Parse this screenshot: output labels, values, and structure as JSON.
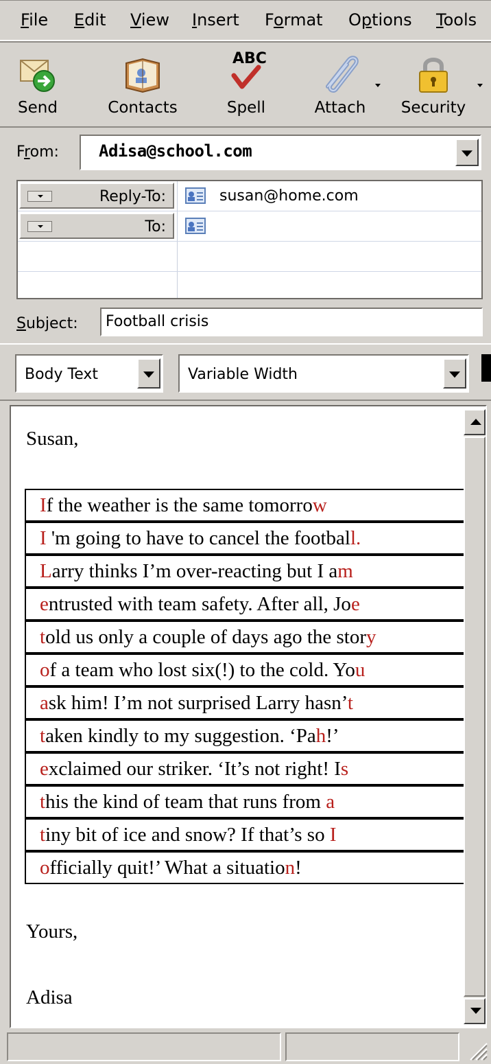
{
  "menu": [
    {
      "label": "File",
      "ul": "F",
      "rest": "ile"
    },
    {
      "label": "Edit",
      "ul": "E",
      "rest": "dit"
    },
    {
      "label": "View",
      "ul": "V",
      "rest": "iew"
    },
    {
      "label": "Insert",
      "ul": "I",
      "rest": "nsert"
    },
    {
      "label": "Format",
      "pre": "F",
      "ul": "o",
      "rest": "rmat"
    },
    {
      "label": "Options",
      "pre": "O",
      "ul": "p",
      "rest": "tions"
    },
    {
      "label": "Tools",
      "ul": "T",
      "rest": "ools"
    }
  ],
  "toolbar": {
    "send": "Send",
    "contacts": "Contacts",
    "spell": "Spell",
    "spell_icon_text": "ABC",
    "attach": "Attach",
    "security": "Security"
  },
  "from": {
    "label_pre": "F",
    "label_ul": "r",
    "label_rest": "om:",
    "value": "Adisa@school.com"
  },
  "addresses": [
    {
      "type": "Reply-To:",
      "value": "susan@home.com"
    },
    {
      "type": "To:",
      "value": ""
    }
  ],
  "subject": {
    "label_ul": "S",
    "label_rest": "ubject:",
    "value": "Football crisis"
  },
  "format": {
    "paragraph_style": "Body Text",
    "font": "Variable Width"
  },
  "body": {
    "greeting": "Susan,",
    "lines": [
      {
        "first": "I",
        "middle": "f the weather is the same tomorro",
        "last": "w"
      },
      {
        "first": "I",
        "middle": " 'm going to have to cancel the footbal",
        "last": "l."
      },
      {
        "first": "L",
        "middle": "arry thinks I’m over-reacting but I a",
        "last": "m"
      },
      {
        "first": "e",
        "middle": "ntrusted with team safety. After all,  Jo",
        "last": "e"
      },
      {
        "first": "t",
        "middle": "old us only a couple of days  ago the stor",
        "last": "y"
      },
      {
        "first": "o",
        "middle": "f a team who lost six(!) to the cold. Yo",
        "last": "u"
      },
      {
        "first": "a",
        "middle": "sk him! I’m not surprised Larry hasn’",
        "last": "t"
      },
      {
        "first": "t",
        "middle": "aken kindly to my suggestion. ‘Pa",
        "last": "h",
        "after": "!’"
      },
      {
        "first": "e",
        "middle": "xclaimed our striker. ‘It’s not right! I",
        "last": "s"
      },
      {
        "first": "t",
        "middle": "his the kind of team that runs from ",
        "last": "a"
      },
      {
        "first": "t",
        "middle": "iny bit of ice and snow? If that’s so ",
        "last": "I"
      },
      {
        "first": "o",
        "middle": "fficially quit!’  What a situatio",
        "last": "n",
        "after": "!"
      }
    ],
    "closing": "Yours,",
    "signature": "Adisa"
  },
  "colors": {
    "highlight_red": "#b8201c",
    "chrome": "#d6d3ce"
  }
}
